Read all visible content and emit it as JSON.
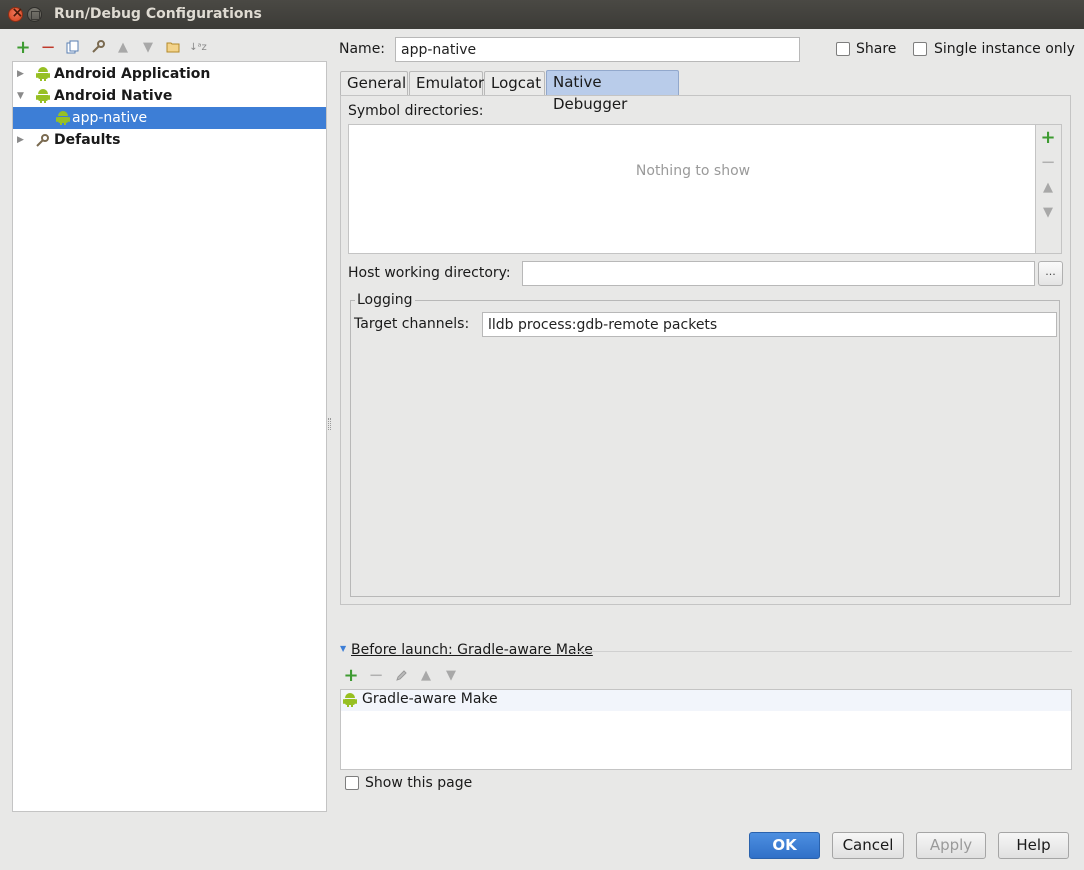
{
  "window": {
    "title": "Run/Debug Configurations"
  },
  "left_toolbar": {
    "icons": [
      "add-icon",
      "remove-icon",
      "copy-icon",
      "wrench-icon",
      "move-up-icon",
      "move-down-icon",
      "folder-icon",
      "sort-icon"
    ]
  },
  "tree": {
    "items": [
      {
        "label": "Android Application",
        "expanded": false,
        "bold": true
      },
      {
        "label": "Android Native",
        "expanded": true,
        "bold": true
      },
      {
        "label": "app-native",
        "selected": true
      },
      {
        "label": "Defaults",
        "expanded": false,
        "bold": true
      }
    ]
  },
  "header": {
    "name_label": "Name:",
    "name_value": "app-native",
    "share_label": "Share",
    "single_instance_label": "Single instance only"
  },
  "tabs": [
    {
      "label": "General"
    },
    {
      "label": "Emulator"
    },
    {
      "label": "Logcat"
    },
    {
      "label": "Native Debugger",
      "active": true
    }
  ],
  "native_debugger": {
    "symbol_dirs_label": "Symbol directories:",
    "empty_text": "Nothing to show",
    "host_dir_label": "Host working directory:",
    "host_dir_value": "",
    "browse_label": "...",
    "logging_title": "Logging",
    "target_channels_label": "Target channels:",
    "target_channels_value": "lldb process:gdb-remote packets"
  },
  "before_launch": {
    "title": "Before launch: Gradle-aware Make",
    "items": [
      "Gradle-aware Make"
    ],
    "show_page_label": "Show this page"
  },
  "buttons": {
    "ok": "OK",
    "cancel": "Cancel",
    "apply": "Apply",
    "help": "Help"
  },
  "colors": {
    "accent": "#3d7ed6",
    "android_green": "#97c024",
    "add_green": "#3e9b32"
  }
}
